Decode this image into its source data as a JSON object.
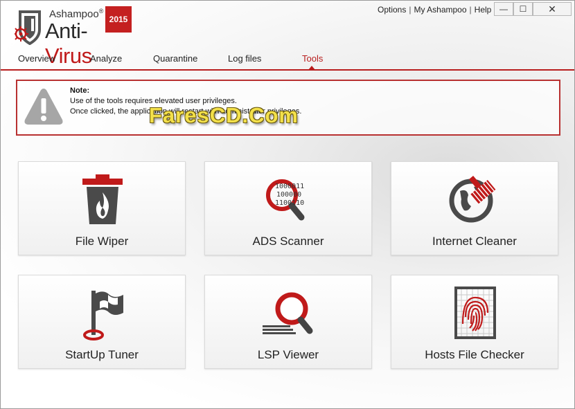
{
  "app": {
    "brand": "Ashampoo",
    "brand_mark": "®",
    "product_prefix": "Anti-",
    "product_suffix": "Virus",
    "year": "2015"
  },
  "top_links": {
    "options": "Options",
    "my_account": "My Ashampoo",
    "help": "Help",
    "separator": "|"
  },
  "window_controls": {
    "minimize": "—",
    "maximize": "☐",
    "close": "✕"
  },
  "tabs": [
    {
      "label": "Overview"
    },
    {
      "label": "Analyze"
    },
    {
      "label": "Quarantine"
    },
    {
      "label": "Log files"
    },
    {
      "label": "Tools",
      "active": true
    }
  ],
  "note": {
    "title": "Note:",
    "line1": "Use of the tools requires elevated user privileges.",
    "line2": "Once clicked, the application will restart with administrator privileges."
  },
  "watermark": "FaresCD.Com",
  "tools": [
    {
      "label": "File Wiper",
      "icon": "trash-fire-icon"
    },
    {
      "label": "ADS Scanner",
      "icon": "binary-magnifier-icon"
    },
    {
      "label": "Internet Cleaner",
      "icon": "globe-brush-icon"
    },
    {
      "label": "StartUp Tuner",
      "icon": "flag-pin-icon"
    },
    {
      "label": "LSP Viewer",
      "icon": "magnifier-icon"
    },
    {
      "label": "Hosts File Checker",
      "icon": "fingerprint-icon"
    }
  ],
  "colors": {
    "accent": "#b81d1d",
    "note_border": "#b83030",
    "icon_gray": "#555555"
  }
}
